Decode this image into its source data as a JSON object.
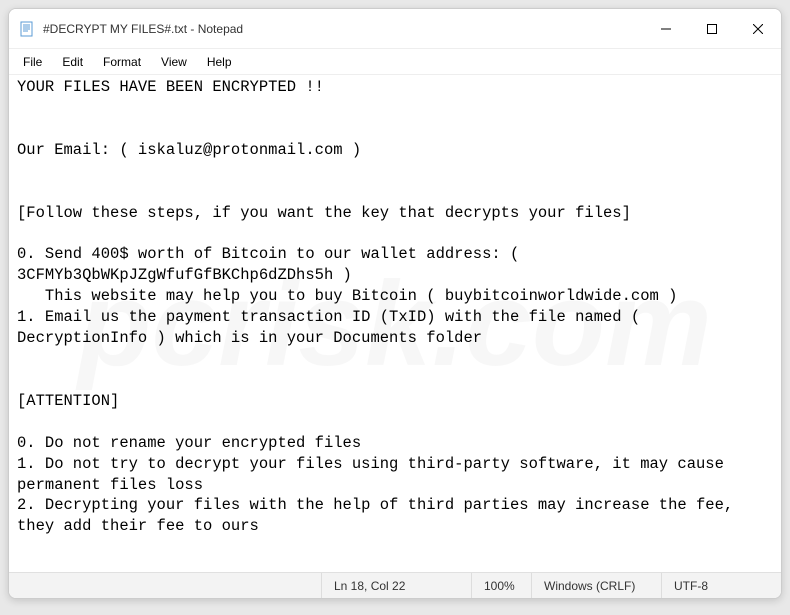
{
  "titlebar": {
    "title": "#DECRYPT MY FILES#.txt - Notepad"
  },
  "menubar": {
    "file": "File",
    "edit": "Edit",
    "format": "Format",
    "view": "View",
    "help": "Help"
  },
  "content": {
    "text": "YOUR FILES HAVE BEEN ENCRYPTED !!\n\n\nOur Email: ( iskaluz@protonmail.com )\n\n\n[Follow these steps, if you want the key that decrypts your files]\n\n0. Send 400$ worth of Bitcoin to our wallet address: ( 3CFMYb3QbWKpJZgWfufGfBKChp6dZDhs5h )\n   This website may help you to buy Bitcoin ( buybitcoinworldwide.com )\n1. Email us the payment transaction ID (TxID) with the file named ( DecryptionInfo ) which is in your Documents folder\n\n\n[ATTENTION]\n\n0. Do not rename your encrypted files\n1. Do not try to decrypt your files using third-party software, it may cause permanent files loss\n2. Decrypting your files with the help of third parties may increase the fee, they add their fee to ours"
  },
  "statusbar": {
    "cursor": "Ln 18, Col 22",
    "zoom": "100%",
    "line_ending": "Windows (CRLF)",
    "encoding": "UTF-8"
  },
  "watermark": "pcrisk.com"
}
